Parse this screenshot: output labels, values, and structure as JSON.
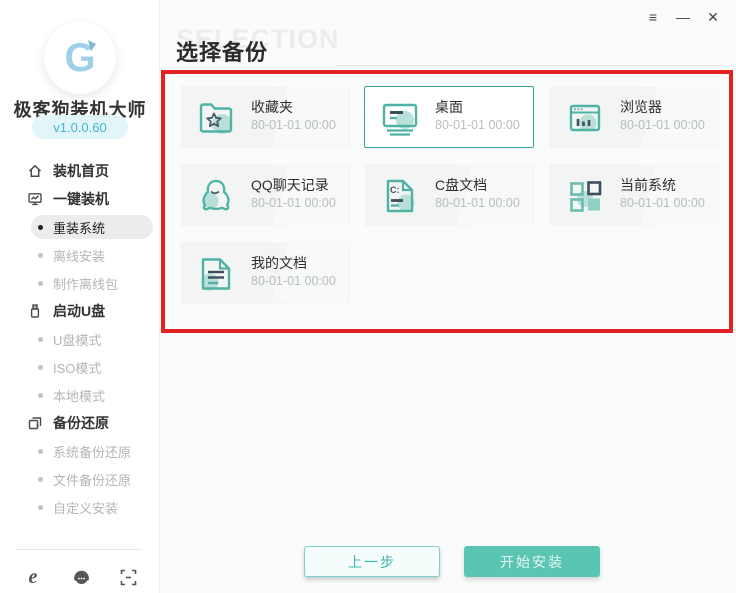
{
  "window": {
    "controls": {
      "menu": "≡",
      "minimize": "—",
      "close": "✕"
    }
  },
  "sidebar": {
    "app_name": "极客狗装机大师",
    "version": "v1.0.0.60",
    "logo_icon": "dog-g-logo",
    "menu": [
      {
        "label": "装机首页",
        "icon": "home-icon",
        "type": "top"
      },
      {
        "label": "一键装机",
        "icon": "monitor-icon",
        "type": "top"
      },
      {
        "label": "重装系统",
        "type": "sub",
        "selected": true
      },
      {
        "label": "离线安装",
        "type": "sub",
        "selected": false
      },
      {
        "label": "制作离线包",
        "type": "sub",
        "selected": false
      },
      {
        "label": "启动U盘",
        "icon": "usb-icon",
        "type": "top"
      },
      {
        "label": "U盘模式",
        "type": "sub",
        "selected": false
      },
      {
        "label": "ISO模式",
        "type": "sub",
        "selected": false
      },
      {
        "label": "本地模式",
        "type": "sub",
        "selected": false
      },
      {
        "label": "备份还原",
        "icon": "restore-icon",
        "type": "top"
      },
      {
        "label": "系统备份还原",
        "type": "sub",
        "selected": false
      },
      {
        "label": "文件备份还原",
        "type": "sub",
        "selected": false
      },
      {
        "label": "自定义安装",
        "type": "sub",
        "selected": false
      }
    ],
    "footer_icons": [
      "ie-browser-icon",
      "customer-service-icon",
      "qr-scan-icon"
    ]
  },
  "main": {
    "watermark": "SELECTION",
    "title": "选择备份",
    "cards": [
      {
        "label": "收藏夹",
        "date": "80-01-01 00:00",
        "icon": "favorites-folder-icon",
        "selected": false
      },
      {
        "label": "桌面",
        "date": "80-01-01 00:00",
        "icon": "desktop-icon",
        "selected": true
      },
      {
        "label": "浏览器",
        "date": "80-01-01 00:00",
        "icon": "browser-window-icon",
        "selected": false
      },
      {
        "label": "QQ聊天记录",
        "date": "80-01-01 00:00",
        "icon": "qq-penguin-icon",
        "selected": false
      },
      {
        "label": "C盘文档",
        "date": "80-01-01 00:00",
        "icon": "c-drive-doc-icon",
        "selected": false
      },
      {
        "label": "当前系统",
        "date": "80-01-01 00:00",
        "icon": "current-system-icon",
        "selected": false
      },
      {
        "label": "我的文档",
        "date": "80-01-01 00:00",
        "icon": "my-documents-icon",
        "selected": false
      }
    ],
    "buttons": {
      "prev": "上一步",
      "start": "开始安装"
    }
  },
  "colors": {
    "accent_teal": "#4fb2a5",
    "accent_teal_light": "#aedbd2",
    "dark_navy": "#3f4e5e",
    "annotation_red": "#e42222",
    "start_button_bg": "#5bc5b3",
    "version_text": "#41b6d2",
    "version_bg": "#e2f6f9"
  }
}
